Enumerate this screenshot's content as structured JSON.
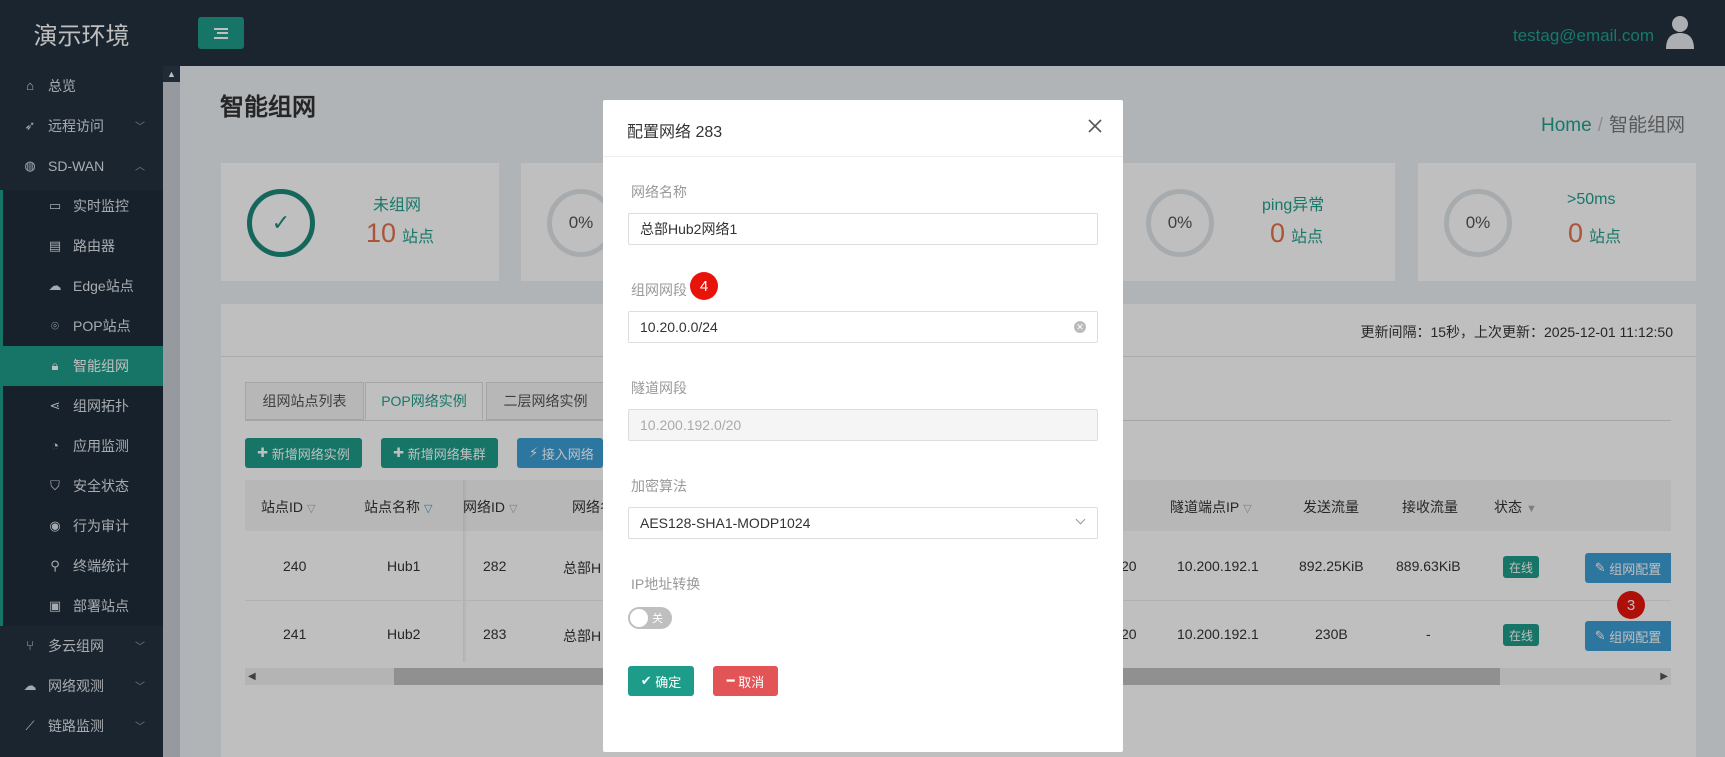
{
  "app": {
    "title": "演示环境",
    "user_email": "testag@email.com"
  },
  "sidebar": {
    "items": [
      {
        "label": "总览",
        "icon": "home-icon"
      },
      {
        "label": "远程访问",
        "icon": "rocket-icon"
      },
      {
        "label": "SD-WAN",
        "icon": "globe-icon"
      },
      {
        "label": "实时监控",
        "icon": "monitor-icon"
      },
      {
        "label": "路由器",
        "icon": "router-icon"
      },
      {
        "label": "Edge站点",
        "icon": "cloud-icon"
      },
      {
        "label": "POP站点",
        "icon": "location-pin-icon"
      },
      {
        "label": "智能组网",
        "icon": "lock-icon"
      },
      {
        "label": "组网拓扑",
        "icon": "share-icon"
      },
      {
        "label": "应用监测",
        "icon": "pie-chart-icon"
      },
      {
        "label": "安全状态",
        "icon": "shield-icon"
      },
      {
        "label": "行为审计",
        "icon": "eye-icon"
      },
      {
        "label": "终端统计",
        "icon": "search-icon"
      },
      {
        "label": "部署站点",
        "icon": "box-icon"
      },
      {
        "label": "多云组网",
        "icon": "fork-icon"
      },
      {
        "label": "网络观测",
        "icon": "cloud-icon"
      },
      {
        "label": "链路监测",
        "icon": "line-chart-icon"
      }
    ]
  },
  "page": {
    "title": "智能组网",
    "breadcrumb": {
      "home": "Home",
      "current": "智能组网"
    },
    "update_info": "更新间隔：15秒，上次更新：2025-12-01 11:12:50"
  },
  "stats": [
    {
      "label": "未组网",
      "value": "10",
      "unit": "站点",
      "ring": "✓"
    },
    {
      "ring": "0%"
    },
    {
      "label": "ping异常",
      "value": "0",
      "unit": "站点",
      "ring": "0%"
    },
    {
      "label": ">50ms",
      "value": "0",
      "unit": "站点",
      "ring": "0%"
    }
  ],
  "tabs": [
    "组网站点列表",
    "POP网络实例",
    "二层网络实例"
  ],
  "actions": {
    "add_instance": "新增网络实例",
    "add_cluster": "新增网络集群",
    "connect": "接入网络"
  },
  "table": {
    "headers": {
      "site_id": "站点ID",
      "site_name": "站点名称",
      "network_id": "网络ID",
      "network_name": "网络名",
      "tunnel_ip": "隧道端点IP",
      "tx": "发送流量",
      "rx": "接收流量",
      "status": "状态"
    },
    "rows": [
      {
        "site_id": "240",
        "site_name": "Hub1",
        "network_id": "282",
        "network_name": "总部H",
        "subnet_tail": "20",
        "tunnel_ip": "10.200.192.1",
        "tx": "892.25KiB",
        "rx": "889.63KiB",
        "status": "在线",
        "action": "组网配置"
      },
      {
        "site_id": "241",
        "site_name": "Hub2",
        "network_id": "283",
        "network_name": "总部H",
        "subnet_tail": "20",
        "tunnel_ip": "10.200.192.1",
        "tx": "230B",
        "rx": "-",
        "status": "在线",
        "action": "组网配置"
      }
    ]
  },
  "modal": {
    "title": "配置网络 283",
    "fields": {
      "name_label": "网络名称",
      "name_value": "总部Hub2网络1",
      "subnet_label": "组网网段",
      "subnet_value": "10.20.0.0/24",
      "tunnel_label": "隧道网段",
      "tunnel_value": "10.200.192.0/20",
      "cipher_label": "加密算法",
      "cipher_value": "AES128-SHA1-MODP1024",
      "nat_label": "IP地址转换",
      "nat_state": "关"
    },
    "confirm": "确定",
    "cancel": "取消"
  },
  "markers": {
    "step3": "3",
    "step4": "4"
  },
  "colors": {
    "accent": "#1e9c8a",
    "header_bg": "#233240",
    "value_orange": "#e0734a",
    "marker_red": "#e8140c",
    "cancel_red": "#e25456",
    "info_blue": "#3c9ed6"
  }
}
